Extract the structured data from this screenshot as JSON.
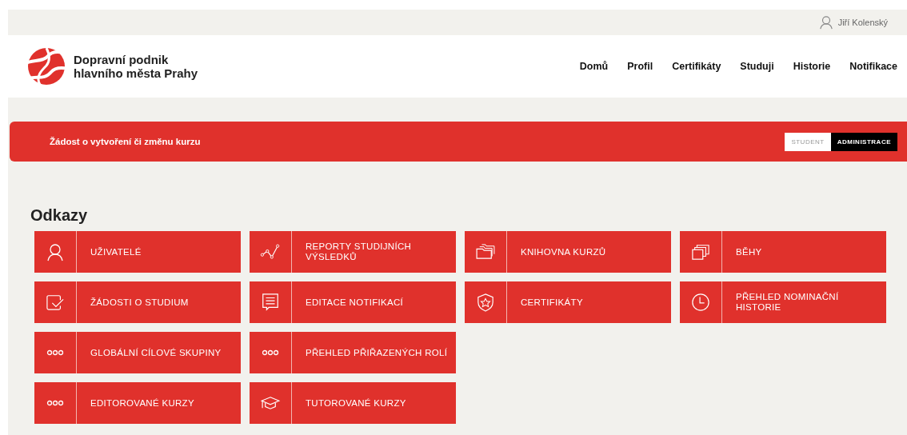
{
  "user": {
    "name": "Jiří Kolenský"
  },
  "logo": {
    "line1": "Dopravní podnik",
    "line2": "hlavního města Prahy"
  },
  "nav": [
    "Domů",
    "Profil",
    "Certifikáty",
    "Studuji",
    "Historie",
    "Notifikace"
  ],
  "banner": {
    "title": "Žádost o vytvoření či změnu kurzu",
    "modes": [
      {
        "label": "STUDENT",
        "selected": false
      },
      {
        "label": "ADMINISTRACE",
        "selected": true
      }
    ]
  },
  "section": {
    "title": "Odkazy"
  },
  "tile_rows": [
    [
      {
        "label": "UŽIVATELÉ",
        "kind": "user"
      },
      {
        "label": "REPORTY STUDIJNÍCH VÝSLEDKŮ",
        "kind": "chart"
      },
      {
        "label": "KNIHOVNA KURZŮ",
        "kind": "folders"
      },
      {
        "label": "BĚHY",
        "kind": "stack"
      }
    ],
    [
      {
        "label": "ŽÁDOSTI O STUDIUM",
        "kind": "check"
      },
      {
        "label": "EDITACE NOTIFIKACÍ",
        "kind": "message"
      },
      {
        "label": "CERTIFIKÁTY",
        "kind": "shield"
      },
      {
        "label": "PŘEHLED NOMINAČNÍ HISTORIE",
        "kind": "clock"
      }
    ],
    [
      {
        "label": "GLOBÁLNÍ CÍLOVÉ SKUPINY",
        "kind": "dots"
      },
      {
        "label": "PŘEHLED PŘIŘAZENÝCH ROLÍ",
        "kind": "dots"
      }
    ],
    [
      {
        "label": "EDITOROVANÉ KURZY",
        "kind": "dots"
      },
      {
        "label": "TUTOROVANÉ KURZY",
        "kind": "cap"
      }
    ]
  ]
}
